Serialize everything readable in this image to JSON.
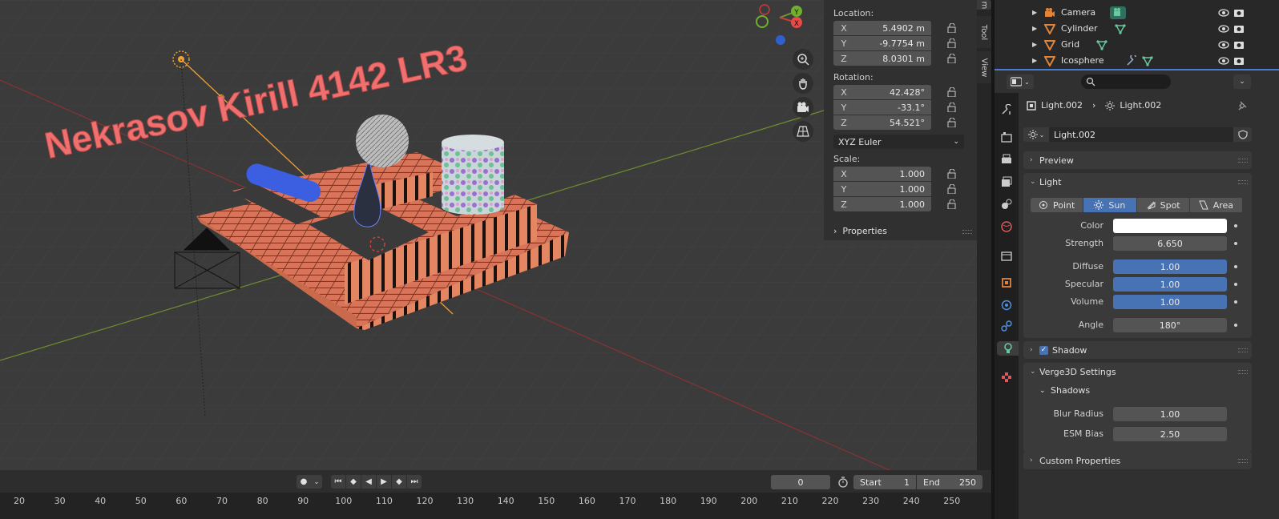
{
  "viewport": {
    "scene_text": "Nekrasov Kirill 4142 LR3",
    "gizmo": {
      "x": "X",
      "y": "Y"
    }
  },
  "npanel": {
    "location_label": "Location:",
    "location": [
      {
        "axis": "X",
        "value": "5.4902 m"
      },
      {
        "axis": "Y",
        "value": "-9.7754 m"
      },
      {
        "axis": "Z",
        "value": "8.0301 m"
      }
    ],
    "rotation_label": "Rotation:",
    "rotation": [
      {
        "axis": "X",
        "value": "42.428°"
      },
      {
        "axis": "Y",
        "value": "-33.1°"
      },
      {
        "axis": "Z",
        "value": "54.521°"
      }
    ],
    "rotation_mode": "XYZ Euler",
    "scale_label": "Scale:",
    "scale": [
      {
        "axis": "X",
        "value": "1.000"
      },
      {
        "axis": "Y",
        "value": "1.000"
      },
      {
        "axis": "Z",
        "value": "1.000"
      }
    ],
    "properties_label": "Properties"
  },
  "side_tabs": {
    "item": "m",
    "tool": "Tool",
    "view": "View"
  },
  "outliner": {
    "rows": [
      {
        "name": "Camera"
      },
      {
        "name": "Cylinder"
      },
      {
        "name": "Grid"
      },
      {
        "name": "Icosphere"
      }
    ]
  },
  "properties": {
    "breadcrumb_object": "Light.002",
    "breadcrumb_data": "Light.002",
    "datablock_name": "Light.002",
    "preview_label": "Preview",
    "light_label": "Light",
    "light_types": [
      "Point",
      "Sun",
      "Spot",
      "Area"
    ],
    "active_light_type": "Sun",
    "color_label": "Color",
    "color_value": "#ffffff",
    "strength_label": "Strength",
    "strength": "6.650",
    "diffuse_label": "Diffuse",
    "diffuse": "1.00",
    "specular_label": "Specular",
    "specular": "1.00",
    "volume_label": "Volume",
    "volume": "1.00",
    "angle_label": "Angle",
    "angle": "180°",
    "shadow_label": "Shadow",
    "shadow_enabled": true,
    "verge_label": "Verge3D Settings",
    "shadows_label": "Shadows",
    "blur_radius_label": "Blur Radius",
    "blur_radius": "1.00",
    "esm_bias_label": "ESM Bias",
    "esm_bias": "2.50",
    "custom_props_label": "Custom Properties"
  },
  "timeline": {
    "current_frame": "0",
    "start_label": "Start",
    "start": "1",
    "end_label": "End",
    "end": "250",
    "ruler": [
      "20",
      "30",
      "40",
      "50",
      "60",
      "70",
      "80",
      "90",
      "100",
      "110",
      "120",
      "130",
      "140",
      "150",
      "160",
      "170",
      "180",
      "190",
      "200",
      "210",
      "220",
      "230",
      "240",
      "250"
    ]
  },
  "colors": {
    "accent_blue": "#4772b3",
    "viewport_bg": "#3b3b3b",
    "text_3d": "#f07070",
    "brick": "#e0805a"
  }
}
